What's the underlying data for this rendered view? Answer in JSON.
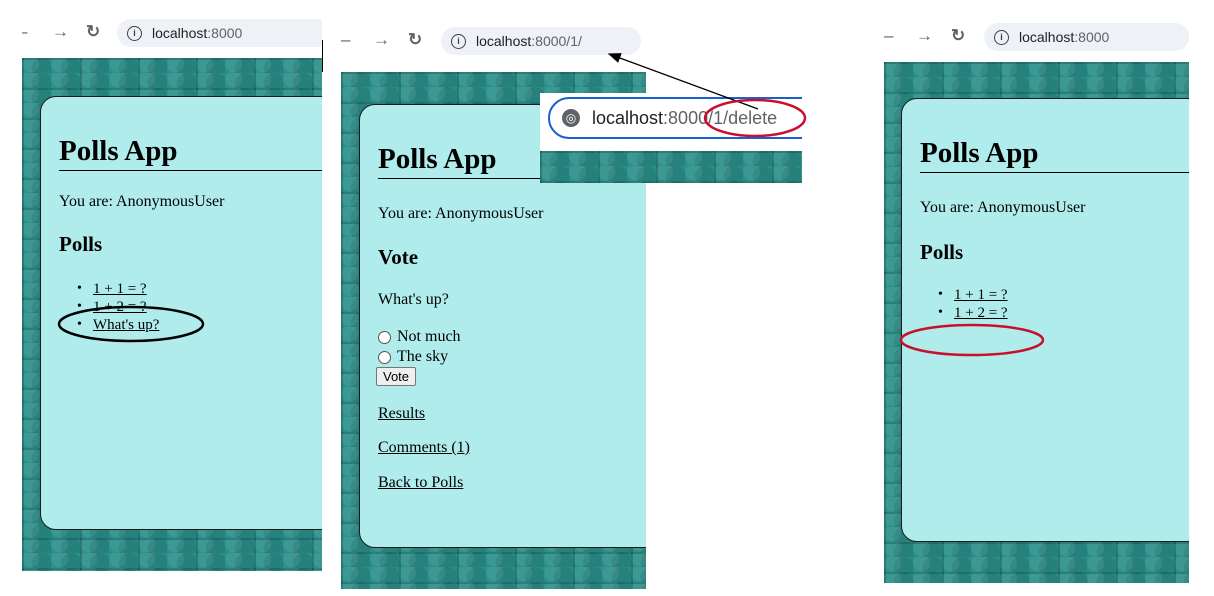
{
  "panels": [
    {
      "url_host": "localhost",
      "url_path": ":8000",
      "app_title": "Polls App",
      "user_line": "You are: AnonymousUser",
      "section_heading": "Polls",
      "polls": [
        "1 + 1 = ?",
        "1 + 2 = ?",
        "What's up?"
      ]
    },
    {
      "url_host": "localhost",
      "url_path": ":8000/1/",
      "app_title": "Polls App",
      "user_line": "You are: AnonymousUser",
      "section_heading": "Vote",
      "question": "What's up?",
      "choices": [
        "Not much",
        "The sky"
      ],
      "vote_button": "Vote",
      "results_link": "Results",
      "comments_link": "Comments (1)",
      "back_link": "Back to Polls"
    },
    {
      "url_host": "localhost",
      "url_path": ":8000",
      "app_title": "Polls App",
      "user_line": "You are: AnonymousUser",
      "section_heading": "Polls",
      "polls": [
        "1 + 1 = ?",
        "1 + 2 = ?"
      ]
    }
  ],
  "zoomed_url": {
    "host": "localhost",
    "path_before": ":800",
    "path_highlight": "0/1/delete"
  },
  "nav_icons": [
    "back-arrow-icon",
    "forward-arrow-icon",
    "reload-icon",
    "info-icon",
    "globe-icon"
  ],
  "colors": {
    "card_bg": "#b0ecec",
    "tile_bg": "#2a8f8a",
    "annotation_black": "#000000",
    "annotation_red": "#c8102e",
    "focus_ring_blue": "#1a5fd0"
  }
}
